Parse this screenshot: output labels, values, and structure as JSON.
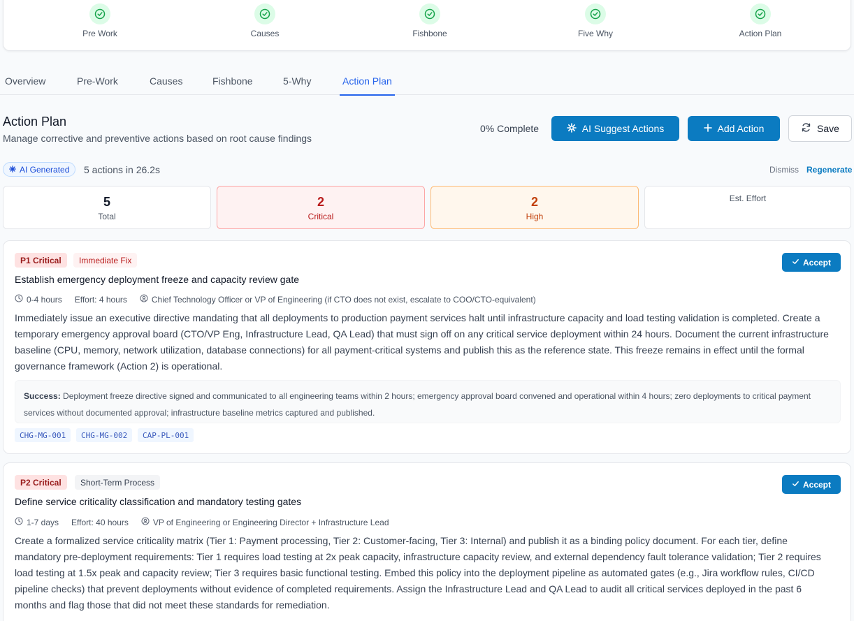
{
  "steps": [
    {
      "label": "Pre Work",
      "icon": "check-circle-icon"
    },
    {
      "label": "Causes",
      "icon": "check-circle-icon"
    },
    {
      "label": "Fishbone",
      "icon": "check-circle-icon"
    },
    {
      "label": "Five Why",
      "icon": "check-circle-icon"
    },
    {
      "label": "Action Plan",
      "icon": "check-circle-icon"
    }
  ],
  "tabs": [
    "Overview",
    "Pre-Work",
    "Causes",
    "Fishbone",
    "5-Why",
    "Action Plan"
  ],
  "active_tab": "Action Plan",
  "header": {
    "title": "Action Plan",
    "subtitle": "Manage corrective and preventive actions based on root cause findings",
    "completion": "0% Complete",
    "ai_suggest_label": "AI Suggest Actions",
    "add_action_label": "Add Action",
    "save_label": "Save"
  },
  "ai": {
    "badge": "AI Generated",
    "meta": "5 actions in 26.2s",
    "dismiss": "Dismiss",
    "regenerate": "Regenerate"
  },
  "stats": {
    "total": {
      "value": "5",
      "label": "Total"
    },
    "critical": {
      "value": "2",
      "label": "Critical"
    },
    "high": {
      "value": "2",
      "label": "High"
    },
    "effort": {
      "label": "Est. Effort"
    }
  },
  "actions": [
    {
      "priority": "P1 Critical",
      "type": "Immediate Fix",
      "title": "Establish emergency deployment freeze and capacity review gate",
      "timeframe": "0-4 hours",
      "effort": "Effort: 4 hours",
      "owner": "Chief Technology Officer or VP of Engineering (if CTO does not exist, escalate to COO/CTO-equivalent)",
      "description": "Immediately issue an executive directive mandating that all deployments to production payment services halt until infrastructure capacity and load testing validation is completed. Create a temporary emergency approval board (CTO/VP Eng, Infrastructure Lead, QA Lead) that must sign off on any critical service deployment within 24 hours. Document the current infrastructure baseline (CPU, memory, network utilization, database connections) for all payment-critical systems and publish this as the reference state. This freeze remains in effect until the formal governance framework (Action 2) is operational.",
      "success_label": "Success:",
      "success": "Deployment freeze directive signed and communicated to all engineering teams within 2 hours; emergency approval board convened and operational within 4 hours; zero deployments to critical payment services without documented approval; infrastructure baseline metrics captured and published.",
      "refs": [
        "CHG-MG-001",
        "CHG-MG-002",
        "CAP-PL-001"
      ],
      "accept_label": "Accept"
    },
    {
      "priority": "P2 Critical",
      "type": "Short-Term Process",
      "title": "Define service criticality classification and mandatory testing gates",
      "timeframe": "1-7 days",
      "effort": "Effort: 40 hours",
      "owner": "VP of Engineering or Engineering Director + Infrastructure Lead",
      "description": "Create a formalized service criticality matrix (Tier 1: Payment processing, Tier 2: Customer-facing, Tier 3: Internal) and publish it as a binding policy document. For each tier, define mandatory pre-deployment requirements: Tier 1 requires load testing at 2x peak capacity, infrastructure capacity review, and external dependency fault tolerance validation; Tier 2 requires load testing at 1.5x peak and capacity review; Tier 3 requires basic functional testing. Embed this policy into the deployment pipeline as automated gates (e.g., Jira workflow rules, CI/CD pipeline checks) that prevent deployments without evidence of completed requirements. Assign the Infrastructure Lead and QA Lead to audit all critical services deployed in the past 6 months and flag those that did not meet these standards for remediation.",
      "accept_label": "Accept"
    }
  ],
  "colors": {
    "accent": "#0b7bc1",
    "success": "#16a34a",
    "critical": "#b91c1c",
    "high": "#c2410c"
  }
}
